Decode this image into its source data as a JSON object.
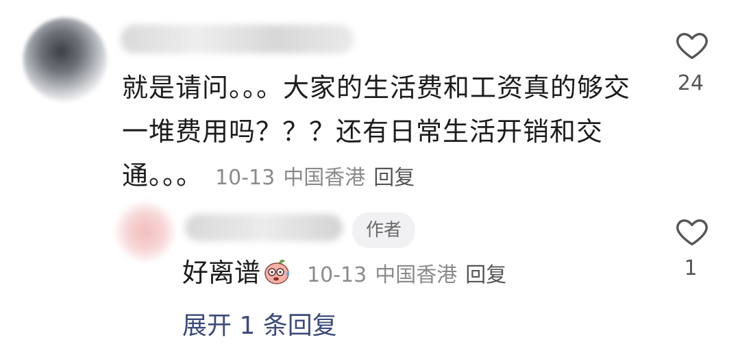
{
  "comment": {
    "text": "就是请问。。。大家的生活费和工资真的够交一堆费用吗？？？还有日常生活开销和交通。。。",
    "date": "10-13",
    "location": "中国香港",
    "reply_label": "回复",
    "likes": "24"
  },
  "reply": {
    "badge": "作者",
    "text": "好离谱",
    "emoji_icon": "sweat-face-emoji-icon",
    "date": "10-13",
    "location": "中国香港",
    "reply_label": "回复",
    "likes": "1"
  },
  "expand_label": "展开 1 条回复",
  "colors": {
    "link": "#3b4a7a",
    "meta": "#8a8a8a",
    "badge_bg": "#f1f1f3"
  }
}
